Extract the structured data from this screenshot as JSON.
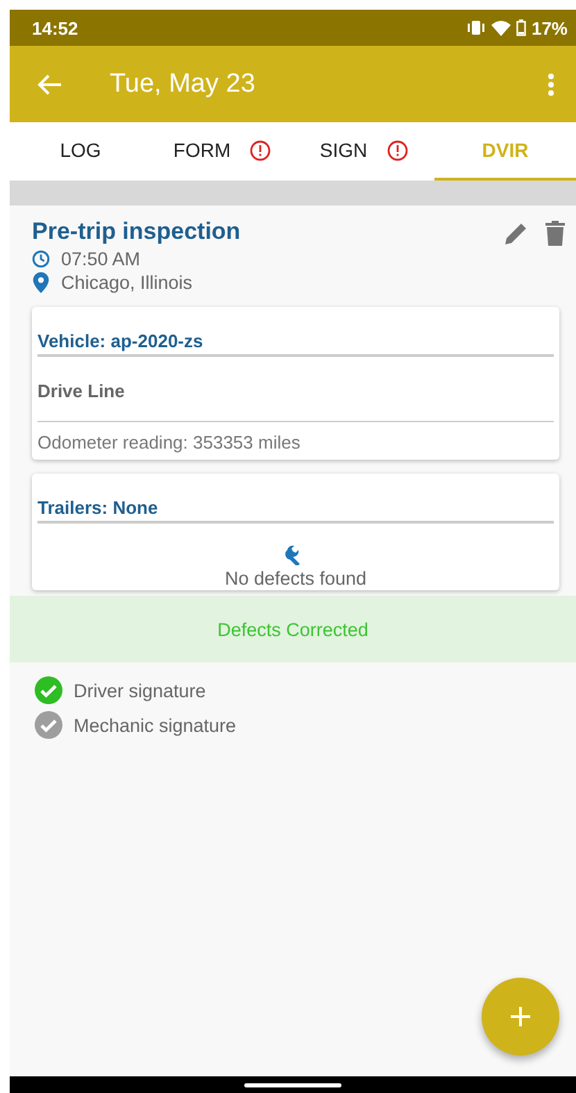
{
  "status_bar": {
    "time": "14:52",
    "battery": "17%"
  },
  "app_bar": {
    "title": "Tue, May 23"
  },
  "tabs": [
    {
      "label": "LOG",
      "warning": false,
      "selected": false
    },
    {
      "label": "FORM",
      "warning": true,
      "selected": false
    },
    {
      "label": "SIGN",
      "warning": true,
      "selected": false
    },
    {
      "label": "DVIR",
      "warning": false,
      "selected": true
    }
  ],
  "inspection": {
    "title": "Pre-trip inspection",
    "time": "07:50 AM",
    "location": "Chicago, Illinois"
  },
  "vehicle_card": {
    "heading": "Vehicle: ap-2020-zs",
    "defect": "Drive Line",
    "odometer": "Odometer reading: 353353 miles"
  },
  "trailers_card": {
    "heading": "Trailers: None",
    "message": "No defects found"
  },
  "status_banner": "Defects Corrected",
  "signatures": [
    {
      "label": "Driver signature",
      "signed": true
    },
    {
      "label": "Mechanic signature",
      "signed": false
    }
  ]
}
